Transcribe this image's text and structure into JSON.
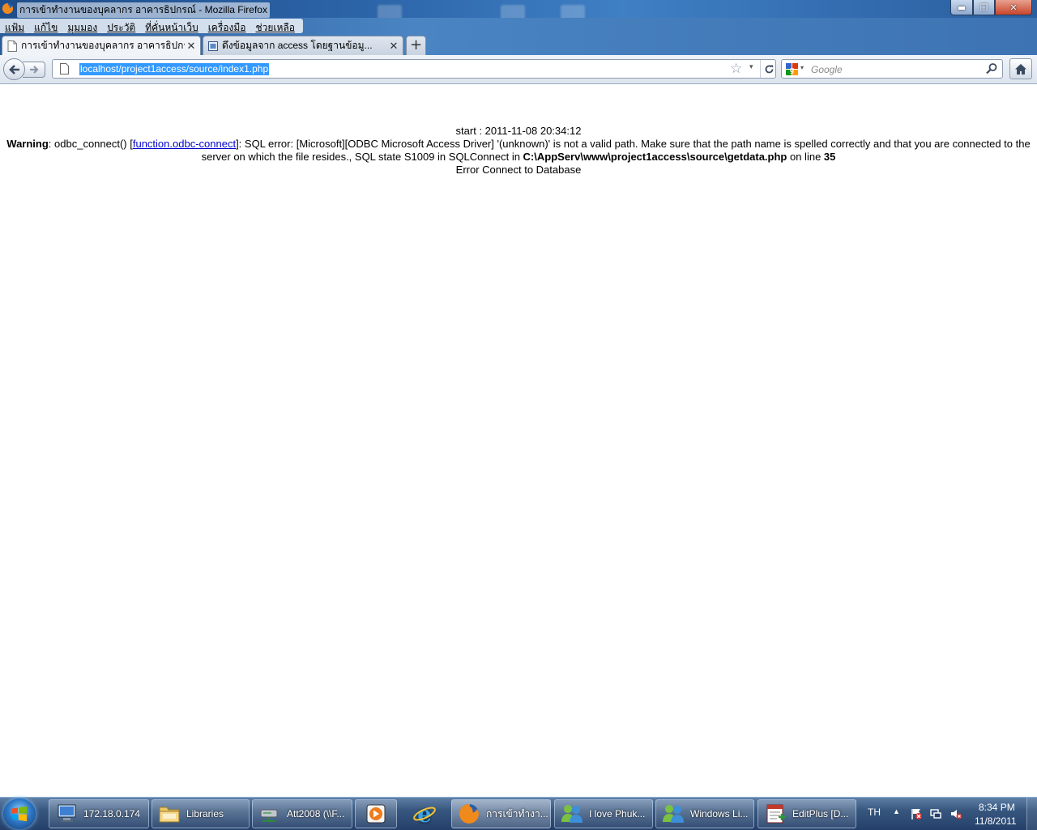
{
  "window": {
    "title": "การเข้าทำงานของบุคลากร อาคารธิปกรณ์ - Mozilla Firefox",
    "min_glyph": "▬",
    "max_glyph": "❐",
    "close_glyph": "✕"
  },
  "menubar": {
    "items": [
      "แฟ้ม",
      "แก้ไข",
      "มุมมอง",
      "ประวัติ",
      "ที่คั่นหน้าเว็บ",
      "เครื่องมือ",
      "ช่วยเหลือ"
    ]
  },
  "tabs": [
    {
      "label": "การเข้าทำงานของบุคลากร อาคารธิปกรณ์",
      "active": true,
      "close": "✕"
    },
    {
      "label": "ดึงข้อมูลจาก access โดยฐานข้อมู...",
      "active": false,
      "close": "✕"
    }
  ],
  "newtab_label": "+",
  "navbar": {
    "url": "localhost/project1access/source/index1.php",
    "search_placeholder": "Google",
    "star_glyph": "☆",
    "drop_glyph": "▾"
  },
  "page": {
    "start_line": "start : 2011-11-08 20:34:12",
    "warning_label": "Warning",
    "warning_pre": ": odbc_connect() [",
    "warning_link": "function.odbc-connect",
    "warning_mid": "]: SQL error: [Microsoft][ODBC Microsoft Access Driver] '(unknown)' is not a valid path. Make sure that the path name is spelled correctly and that you are connected to the server on which the file resides., SQL state S1009 in SQLConnect in ",
    "warning_file": "C:\\AppServ\\www\\project1access\\source\\getdata.php",
    "warning_online": " on line ",
    "warning_line": "35",
    "error_line": "Error Connect to Database"
  },
  "taskbar": {
    "tasks": [
      {
        "label": "172.18.0.174",
        "icon": "remote-desktop-icon"
      },
      {
        "label": "Libraries",
        "icon": "folder-icon"
      },
      {
        "label": "Att2008 (\\\\F...",
        "icon": "network-drive-icon"
      },
      {
        "label": "",
        "icon": "media-player-icon"
      },
      {
        "label": "",
        "icon": "internet-explorer-icon"
      },
      {
        "label": "การเข้าทำงา...",
        "icon": "firefox-icon"
      },
      {
        "label": "I love Phuk...",
        "icon": "messenger-icon"
      },
      {
        "label": "Windows Li...",
        "icon": "messenger-icon"
      },
      {
        "label": "EditPlus [D...",
        "icon": "editplus-icon"
      }
    ],
    "tray": {
      "lang": "TH",
      "arrow": "▲",
      "time": "8:34 PM",
      "date": "11/8/2011"
    }
  },
  "colors": {
    "selection": "#3399ff",
    "link": "#0000cc",
    "taskbar": "#24406a"
  }
}
